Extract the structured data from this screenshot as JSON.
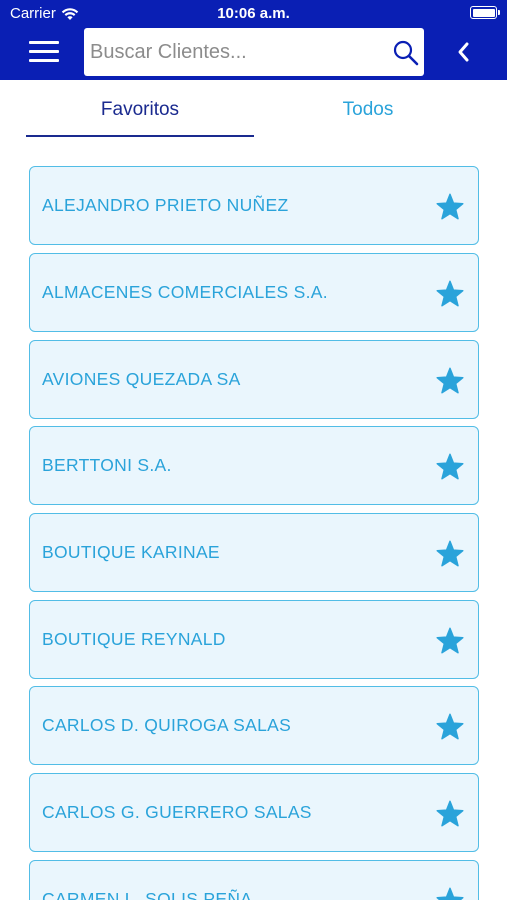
{
  "status_bar": {
    "carrier": "Carrier",
    "time": "10:06 a.m."
  },
  "header": {
    "search_placeholder": "Buscar Clientes...",
    "search_value": "",
    "menu_icon": "hamburger-menu-icon",
    "search_icon": "magnifier-icon",
    "back_icon": "chevron-left-icon"
  },
  "tabs": [
    {
      "label": "Favoritos",
      "active": true
    },
    {
      "label": "Todos",
      "active": false
    }
  ],
  "clients": [
    {
      "name": "ALEJANDRO PRIETO NUÑEZ",
      "favorite": true
    },
    {
      "name": "ALMACENES COMERCIALES S.A.",
      "favorite": true
    },
    {
      "name": "AVIONES QUEZADA SA",
      "favorite": true
    },
    {
      "name": "BERTTONI S.A.",
      "favorite": true
    },
    {
      "name": "BOUTIQUE KARINAE",
      "favorite": true
    },
    {
      "name": "BOUTIQUE REYNALD",
      "favorite": true
    },
    {
      "name": "CARLOS D. QUIROGA SALAS",
      "favorite": true
    },
    {
      "name": "CARLOS G. GUERRERO SALAS",
      "favorite": true
    },
    {
      "name": "CARMEN L. SOLIS PEÑA",
      "favorite": true
    }
  ],
  "colors": {
    "header_bg": "#0a1fb4",
    "active_tab": "#1a2a8f",
    "accent": "#2aa3da",
    "row_bg": "#eaf6fd",
    "row_border": "#52bde6"
  }
}
